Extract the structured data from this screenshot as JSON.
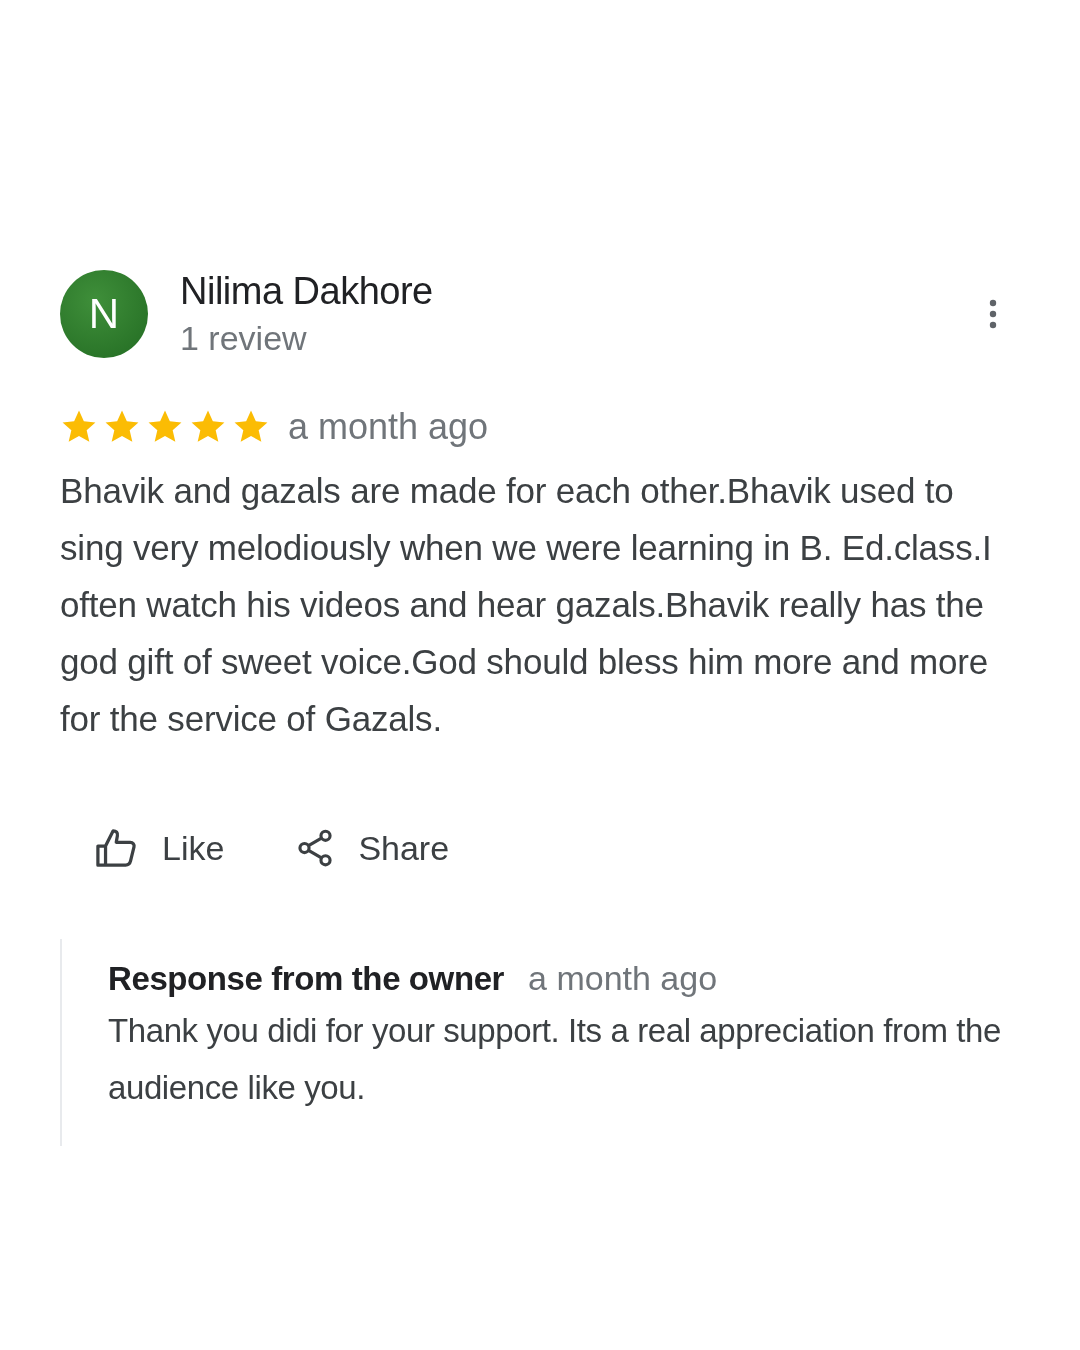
{
  "review": {
    "avatar_letter": "N",
    "author": "Nilima Dakhore",
    "author_meta": "1 review",
    "stars": 5,
    "time": "a month ago",
    "text": "Bhavik and gazals are made for each other.Bhavik used to sing very melodiously when we were learning in B. Ed.class.I often watch his videos and hear gazals.Bhavik really has the god gift of sweet voice.God should bless him more and more for the service of Gazals."
  },
  "actions": [
    {
      "kind": "like",
      "label": "Like"
    },
    {
      "kind": "share",
      "label": "Share"
    }
  ],
  "owner_response": {
    "title": "Response from the owner",
    "time": "a month ago",
    "text": "Thank you didi for your support. Its a real appreciation from the audience like you."
  }
}
